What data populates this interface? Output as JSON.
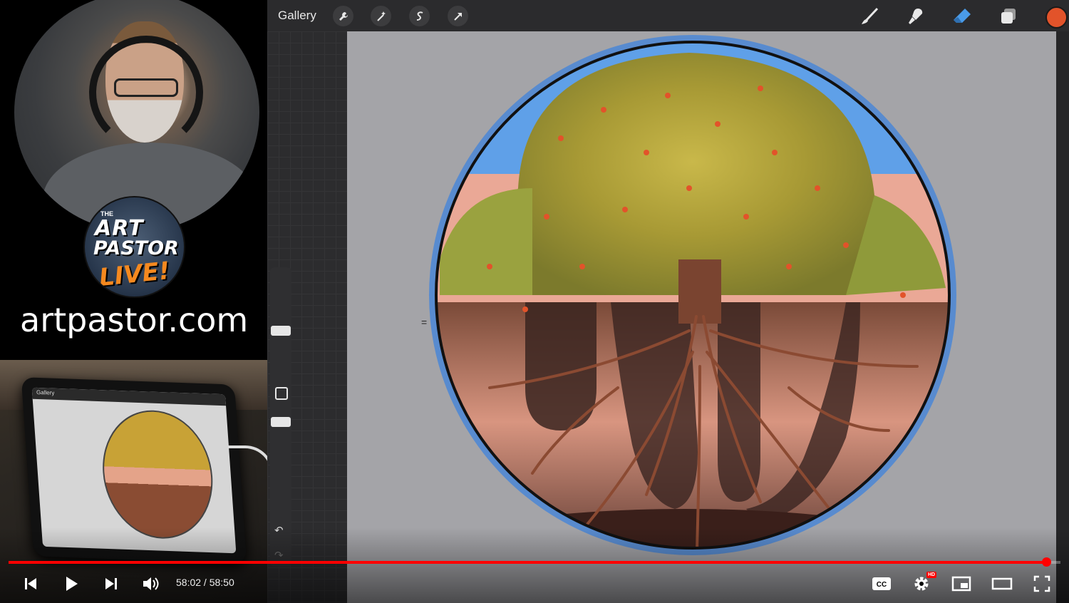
{
  "stream": {
    "logo_small_text": "THE",
    "logo_line1": "ART",
    "logo_line2": "PASTOR",
    "logo_line3": "LIVE!",
    "site_url": "artpastor.com",
    "overhead_gallery": "Gallery"
  },
  "procreate": {
    "gallery_label": "Gallery",
    "left_tools": [
      "wrench-icon",
      "magic-wand-icon",
      "selection-icon",
      "transform-arrow-icon"
    ],
    "right_tools": [
      "brush-icon",
      "smudge-icon",
      "eraser-icon",
      "layers-icon"
    ],
    "active_tool": "eraser-icon",
    "active_tool_color": "#4a9be8",
    "current_color": "#e2532a"
  },
  "player": {
    "current_time": "58:02",
    "duration": "58:50",
    "time_text": "58:02 / 58:50",
    "progress": 0.9864,
    "progress_color": "#ff0000",
    "hd_badge": "HD",
    "cc_label": "CC"
  }
}
